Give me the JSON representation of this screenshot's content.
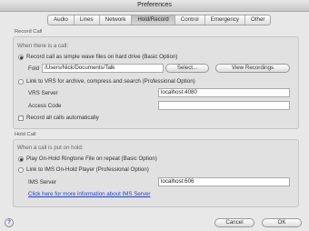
{
  "window": {
    "title": "Preferences"
  },
  "tabs": [
    {
      "label": "Audio"
    },
    {
      "label": "Lines"
    },
    {
      "label": "Network"
    },
    {
      "label": "Hold/Record"
    },
    {
      "label": "Control"
    },
    {
      "label": "Emergency"
    },
    {
      "label": "Other"
    }
  ],
  "active_tab": "Hold/Record",
  "record_call": {
    "group_label": "Record Call",
    "heading": "When there is a call:",
    "option_simple": "Record call as simple wave files on hard drive (Basic Option)",
    "folder_label": "Fold",
    "folder_value": "/Users/Nick/Documents/Talk",
    "select_button": "Select...",
    "view_button": "View Recordings",
    "option_vrs": "Link to VRS for archive, compress and search (Professional Option)",
    "vrs_server_label": "VRS Server",
    "vrs_server_value": "localhost:4080",
    "access_code_label": "Access Code",
    "access_code_value": "",
    "auto_label": "Record all calls automatically"
  },
  "hold_call": {
    "group_label": "Hold Call",
    "heading": "When a call is put on hold:",
    "option_play": "Play On-Hold Ringtone File on repeat (Basic Option)",
    "option_ims": "Link to IMS On-Hold Player (Professional Option)",
    "ims_server_label": "IMS Server",
    "ims_server_value": "localhost:606",
    "info_link": "Click here for more information about IMS Server"
  },
  "footer": {
    "help": "?",
    "cancel": "Cancel",
    "ok": "OK"
  }
}
